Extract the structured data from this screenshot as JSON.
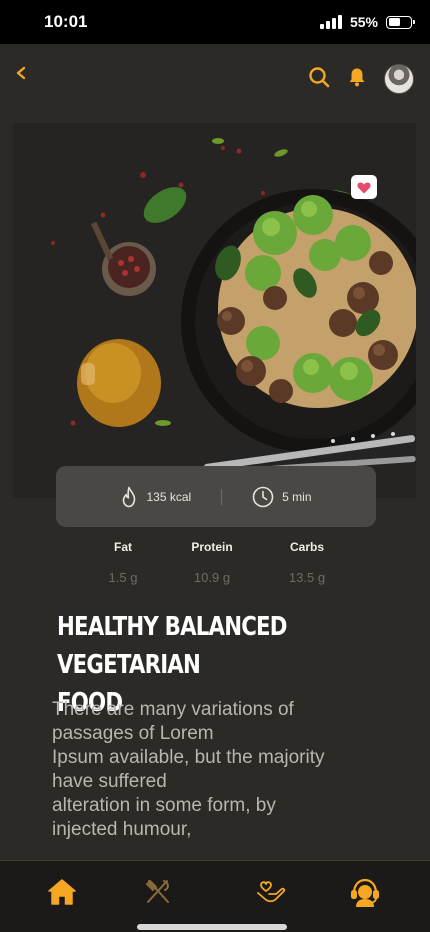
{
  "status": {
    "time": "10:01",
    "battery": "55%"
  },
  "header": {
    "back_icon": "chevron-left-icon",
    "search_icon": "search-icon",
    "bell_icon": "bell-icon"
  },
  "colors": {
    "accent": "#f5a623",
    "background": "#2c2a27",
    "card": "#4a4845",
    "nav": "#1b1a18"
  },
  "recipe": {
    "calories": "135 kcal",
    "time": "5 min",
    "nutrition": [
      {
        "label": "Fat",
        "value": "1.5 g"
      },
      {
        "label": "Protein",
        "value": "10.9 g"
      },
      {
        "label": "Carbs",
        "value": "13.5 g"
      }
    ],
    "title_line1": "HEALTHY BALANCED VEGETARIAN",
    "title_line2": "FOOD",
    "description_lines": [
      "There are many variations of",
      "passages of Lorem",
      "Ipsum available, but the majority",
      "have suffered",
      "alteration in some form, by",
      "injected humour,"
    ]
  },
  "nav": [
    "home-icon",
    "utensils-icon",
    "hand-heart-icon",
    "support-agent-icon"
  ]
}
